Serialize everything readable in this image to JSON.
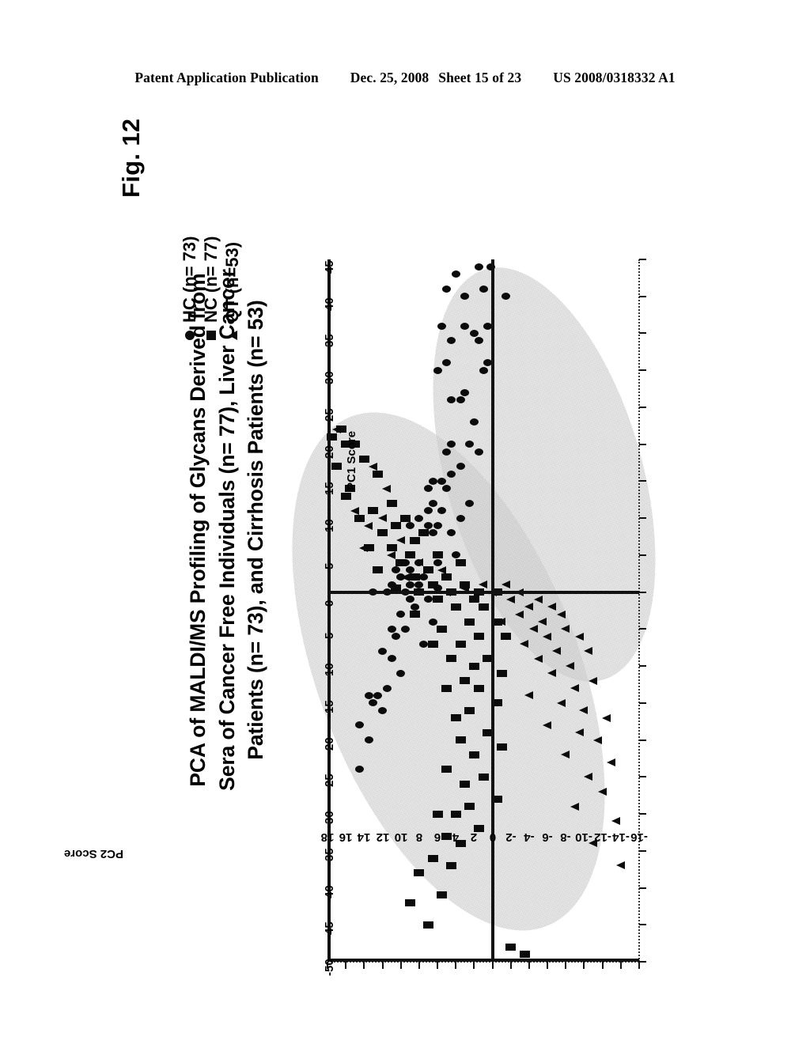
{
  "page_header": {
    "publication": "Patent Application Publication",
    "date": "Dec. 25, 2008",
    "sheet": "Sheet 15 of 23",
    "pub_number": "US 2008/0318332 A1"
  },
  "figure": {
    "label": "Fig. 12",
    "title_lines": [
      "PCA of MALDI/MS Profiling of Glycans Derived from",
      "Sera of Cancer Free Individuals (n= 77), Liver Cancer",
      "Patients (n= 73), and  Cirrhosis Patients (n= 53)"
    ]
  },
  "legend": {
    "position": "top-left",
    "items": [
      {
        "key": "circle",
        "label": "HC (n= 73)",
        "color": "#0b0b0b"
      },
      {
        "key": "square",
        "label": "NC (n= 77)",
        "color": "#0b0b0b"
      },
      {
        "key": "triangle",
        "label": "QT (n=53)",
        "color": "#0b0b0b"
      }
    ]
  },
  "chart_data": {
    "type": "scatter",
    "title": "PCA of MALDI/MS Profiling of Glycans Derived from Sera of Cancer Free Individuals (n= 77), Liver Cancer Patients (n= 73), and  Cirrhosis Patients (n= 53)",
    "xlabel": "PC1 Score",
    "ylabel": "PC2 Score",
    "xlim": [
      -50,
      45
    ],
    "ylim": [
      -16,
      18
    ],
    "xticks": [
      -50,
      -45,
      -40,
      -35,
      -30,
      -25,
      -20,
      -15,
      -10,
      -5,
      0,
      5,
      10,
      15,
      20,
      25,
      30,
      35,
      40,
      45
    ],
    "yticks": [
      18,
      16,
      14,
      12,
      10,
      8,
      6,
      4,
      2,
      0,
      -2,
      -4,
      -6,
      -8,
      -10,
      -12,
      -14,
      -16
    ],
    "grid": false,
    "rotated_90_ccw": true,
    "ellipse_overlays": [
      {
        "group": "HC",
        "fill": "#b9b9b9",
        "opacity": 0.62
      },
      {
        "group": "NC/QT",
        "fill": "#b9b9b9",
        "opacity": 0.62
      }
    ],
    "series": [
      {
        "name": "HC (n= 73)",
        "marker": "circle",
        "color": "#0b0b0b",
        "points": [
          [
            44,
            1.5
          ],
          [
            44,
            0.2
          ],
          [
            43,
            4.0
          ],
          [
            41,
            1.0
          ],
          [
            41,
            5.0
          ],
          [
            40,
            3.0
          ],
          [
            40,
            -1.5
          ],
          [
            36,
            0.5
          ],
          [
            36,
            3.0
          ],
          [
            36,
            5.5
          ],
          [
            35,
            2.0
          ],
          [
            34,
            4.5
          ],
          [
            34,
            1.5
          ],
          [
            31,
            0.5
          ],
          [
            31,
            5.0
          ],
          [
            30,
            1.0
          ],
          [
            30,
            6.0
          ],
          [
            27,
            3.0
          ],
          [
            26,
            4.5
          ],
          [
            26,
            3.5
          ],
          [
            23,
            2.0
          ],
          [
            20,
            2.5
          ],
          [
            20,
            4.5
          ],
          [
            19,
            5.0
          ],
          [
            19,
            1.5
          ],
          [
            17,
            3.5
          ],
          [
            16,
            4.5
          ],
          [
            15,
            6.5
          ],
          [
            15,
            5.5
          ],
          [
            14,
            7.0
          ],
          [
            14,
            5.0
          ],
          [
            12,
            2.5
          ],
          [
            12,
            6.5
          ],
          [
            11,
            7.0
          ],
          [
            11,
            5.5
          ],
          [
            10,
            3.5
          ],
          [
            10,
            8.0
          ],
          [
            9,
            6.0
          ],
          [
            9,
            9.0
          ],
          [
            9,
            7.0
          ],
          [
            8,
            4.5
          ],
          [
            8,
            7.5
          ],
          [
            8,
            6.5
          ],
          [
            5,
            4.0
          ],
          [
            4,
            8.0
          ],
          [
            4,
            9.5
          ],
          [
            4,
            6.0
          ],
          [
            3,
            9.0
          ],
          [
            3,
            10.5
          ],
          [
            2,
            8.5
          ],
          [
            2,
            10.0
          ],
          [
            2,
            7.5
          ],
          [
            1,
            9.0
          ],
          [
            1,
            11.0
          ],
          [
            1,
            8.0
          ],
          [
            0.5,
            6.0
          ],
          [
            0,
            9.5
          ],
          [
            0,
            11.5
          ],
          [
            0,
            13.0
          ],
          [
            -1,
            7.0
          ],
          [
            -1,
            9.0
          ],
          [
            -2,
            8.5
          ],
          [
            -3,
            10.0
          ],
          [
            -4,
            6.5
          ],
          [
            -5,
            9.5
          ],
          [
            -5,
            11.0
          ],
          [
            -6,
            10.5
          ],
          [
            -7,
            7.5
          ],
          [
            -8,
            12.0
          ],
          [
            -9,
            11.0
          ],
          [
            -11,
            10.0
          ],
          [
            -13,
            11.5
          ],
          [
            -14,
            13.5
          ],
          [
            -14,
            12.5
          ],
          [
            -15,
            13.0
          ],
          [
            -16,
            12.0
          ],
          [
            -18,
            14.5
          ],
          [
            -20,
            13.5
          ],
          [
            -24,
            14.5
          ]
        ]
      },
      {
        "name": "NC (n= 77)",
        "marker": "square",
        "color": "#0b0b0b",
        "points": [
          [
            22,
            16.5
          ],
          [
            21,
            17.5
          ],
          [
            20,
            15.0
          ],
          [
            20,
            16.0
          ],
          [
            18,
            14.0
          ],
          [
            17,
            17.0
          ],
          [
            16,
            12.5
          ],
          [
            14,
            15.5
          ],
          [
            13,
            16.0
          ],
          [
            12,
            11.0
          ],
          [
            11,
            13.0
          ],
          [
            10,
            9.5
          ],
          [
            10,
            14.5
          ],
          [
            9,
            10.5
          ],
          [
            8,
            12.0
          ],
          [
            8,
            7.5
          ],
          [
            7,
            8.5
          ],
          [
            6,
            11.0
          ],
          [
            6,
            13.5
          ],
          [
            5,
            6.0
          ],
          [
            5,
            9.0
          ],
          [
            4,
            10.0
          ],
          [
            4,
            3.5
          ],
          [
            3,
            7.0
          ],
          [
            3,
            12.5
          ],
          [
            2,
            5.0
          ],
          [
            2,
            8.5
          ],
          [
            1,
            3.0
          ],
          [
            1,
            6.5
          ],
          [
            0.5,
            10.5
          ],
          [
            0,
            1.5
          ],
          [
            0,
            4.5
          ],
          [
            0,
            8.0
          ],
          [
            0,
            -0.5
          ],
          [
            -1,
            2.0
          ],
          [
            -1,
            6.0
          ],
          [
            -2,
            1.0
          ],
          [
            -2,
            4.0
          ],
          [
            -3,
            8.5
          ],
          [
            -4,
            -0.5
          ],
          [
            -4,
            2.5
          ],
          [
            -5,
            5.5
          ],
          [
            -6,
            1.5
          ],
          [
            -6,
            -1.5
          ],
          [
            -7,
            3.5
          ],
          [
            -7,
            6.5
          ],
          [
            -9,
            0.5
          ],
          [
            -9,
            4.5
          ],
          [
            -10,
            2.0
          ],
          [
            -11,
            -1.0
          ],
          [
            -12,
            3.0
          ],
          [
            -13,
            5.0
          ],
          [
            -13,
            1.5
          ],
          [
            -15,
            -0.5
          ],
          [
            -16,
            2.5
          ],
          [
            -17,
            4.0
          ],
          [
            -19,
            0.5
          ],
          [
            -20,
            3.5
          ],
          [
            -21,
            -1.0
          ],
          [
            -22,
            2.0
          ],
          [
            -24,
            5.0
          ],
          [
            -25,
            1.0
          ],
          [
            -26,
            3.0
          ],
          [
            -28,
            -0.5
          ],
          [
            -29,
            2.5
          ],
          [
            -30,
            6.0
          ],
          [
            -30,
            4.0
          ],
          [
            -32,
            1.5
          ],
          [
            -33,
            5.0
          ],
          [
            -34,
            3.5
          ],
          [
            -36,
            6.5
          ],
          [
            -37,
            4.5
          ],
          [
            -38,
            8.0
          ],
          [
            -41,
            5.5
          ],
          [
            -42,
            9.0
          ],
          [
            -45,
            7.0
          ],
          [
            -48,
            -2.0
          ],
          [
            -49,
            -3.5
          ]
        ]
      },
      {
        "name": "QT (n=53)",
        "marker": "triangle",
        "color": "#0b0b0b",
        "points": [
          [
            22,
            17.0
          ],
          [
            17,
            13.0
          ],
          [
            14,
            11.5
          ],
          [
            11,
            15.0
          ],
          [
            10,
            12.0
          ],
          [
            9,
            13.5
          ],
          [
            7,
            10.0
          ],
          [
            6,
            14.0
          ],
          [
            5,
            11.0
          ],
          [
            4,
            8.0
          ],
          [
            3,
            5.5
          ],
          [
            2,
            9.5
          ],
          [
            1,
            -1.5
          ],
          [
            1,
            1.0
          ],
          [
            0.5,
            3.0
          ],
          [
            0,
            -3.0
          ],
          [
            0,
            0.0
          ],
          [
            0,
            5.0
          ],
          [
            -1,
            -2.0
          ],
          [
            -1,
            -5.0
          ],
          [
            -2,
            -4.0
          ],
          [
            -2,
            -6.5
          ],
          [
            -3,
            -3.0
          ],
          [
            -3,
            -7.5
          ],
          [
            -4,
            -5.5
          ],
          [
            -4,
            -1.0
          ],
          [
            -5,
            -8.0
          ],
          [
            -5,
            -4.5
          ],
          [
            -6,
            -6.0
          ],
          [
            -6,
            -9.5
          ],
          [
            -7,
            -3.5
          ],
          [
            -8,
            -7.0
          ],
          [
            -8,
            -10.5
          ],
          [
            -9,
            -5.0
          ],
          [
            -10,
            -8.5
          ],
          [
            -11,
            -6.5
          ],
          [
            -12,
            -11.0
          ],
          [
            -13,
            -9.0
          ],
          [
            -14,
            -4.0
          ],
          [
            -15,
            -7.5
          ],
          [
            -16,
            -10.0
          ],
          [
            -17,
            -12.5
          ],
          [
            -18,
            -6.0
          ],
          [
            -19,
            -9.5
          ],
          [
            -20,
            -11.5
          ],
          [
            -22,
            -8.0
          ],
          [
            -23,
            -13.0
          ],
          [
            -25,
            -10.5
          ],
          [
            -27,
            -12.0
          ],
          [
            -29,
            -9.0
          ],
          [
            -31,
            -13.5
          ],
          [
            -34,
            -11.0
          ],
          [
            -37,
            -14.0
          ]
        ]
      }
    ]
  }
}
